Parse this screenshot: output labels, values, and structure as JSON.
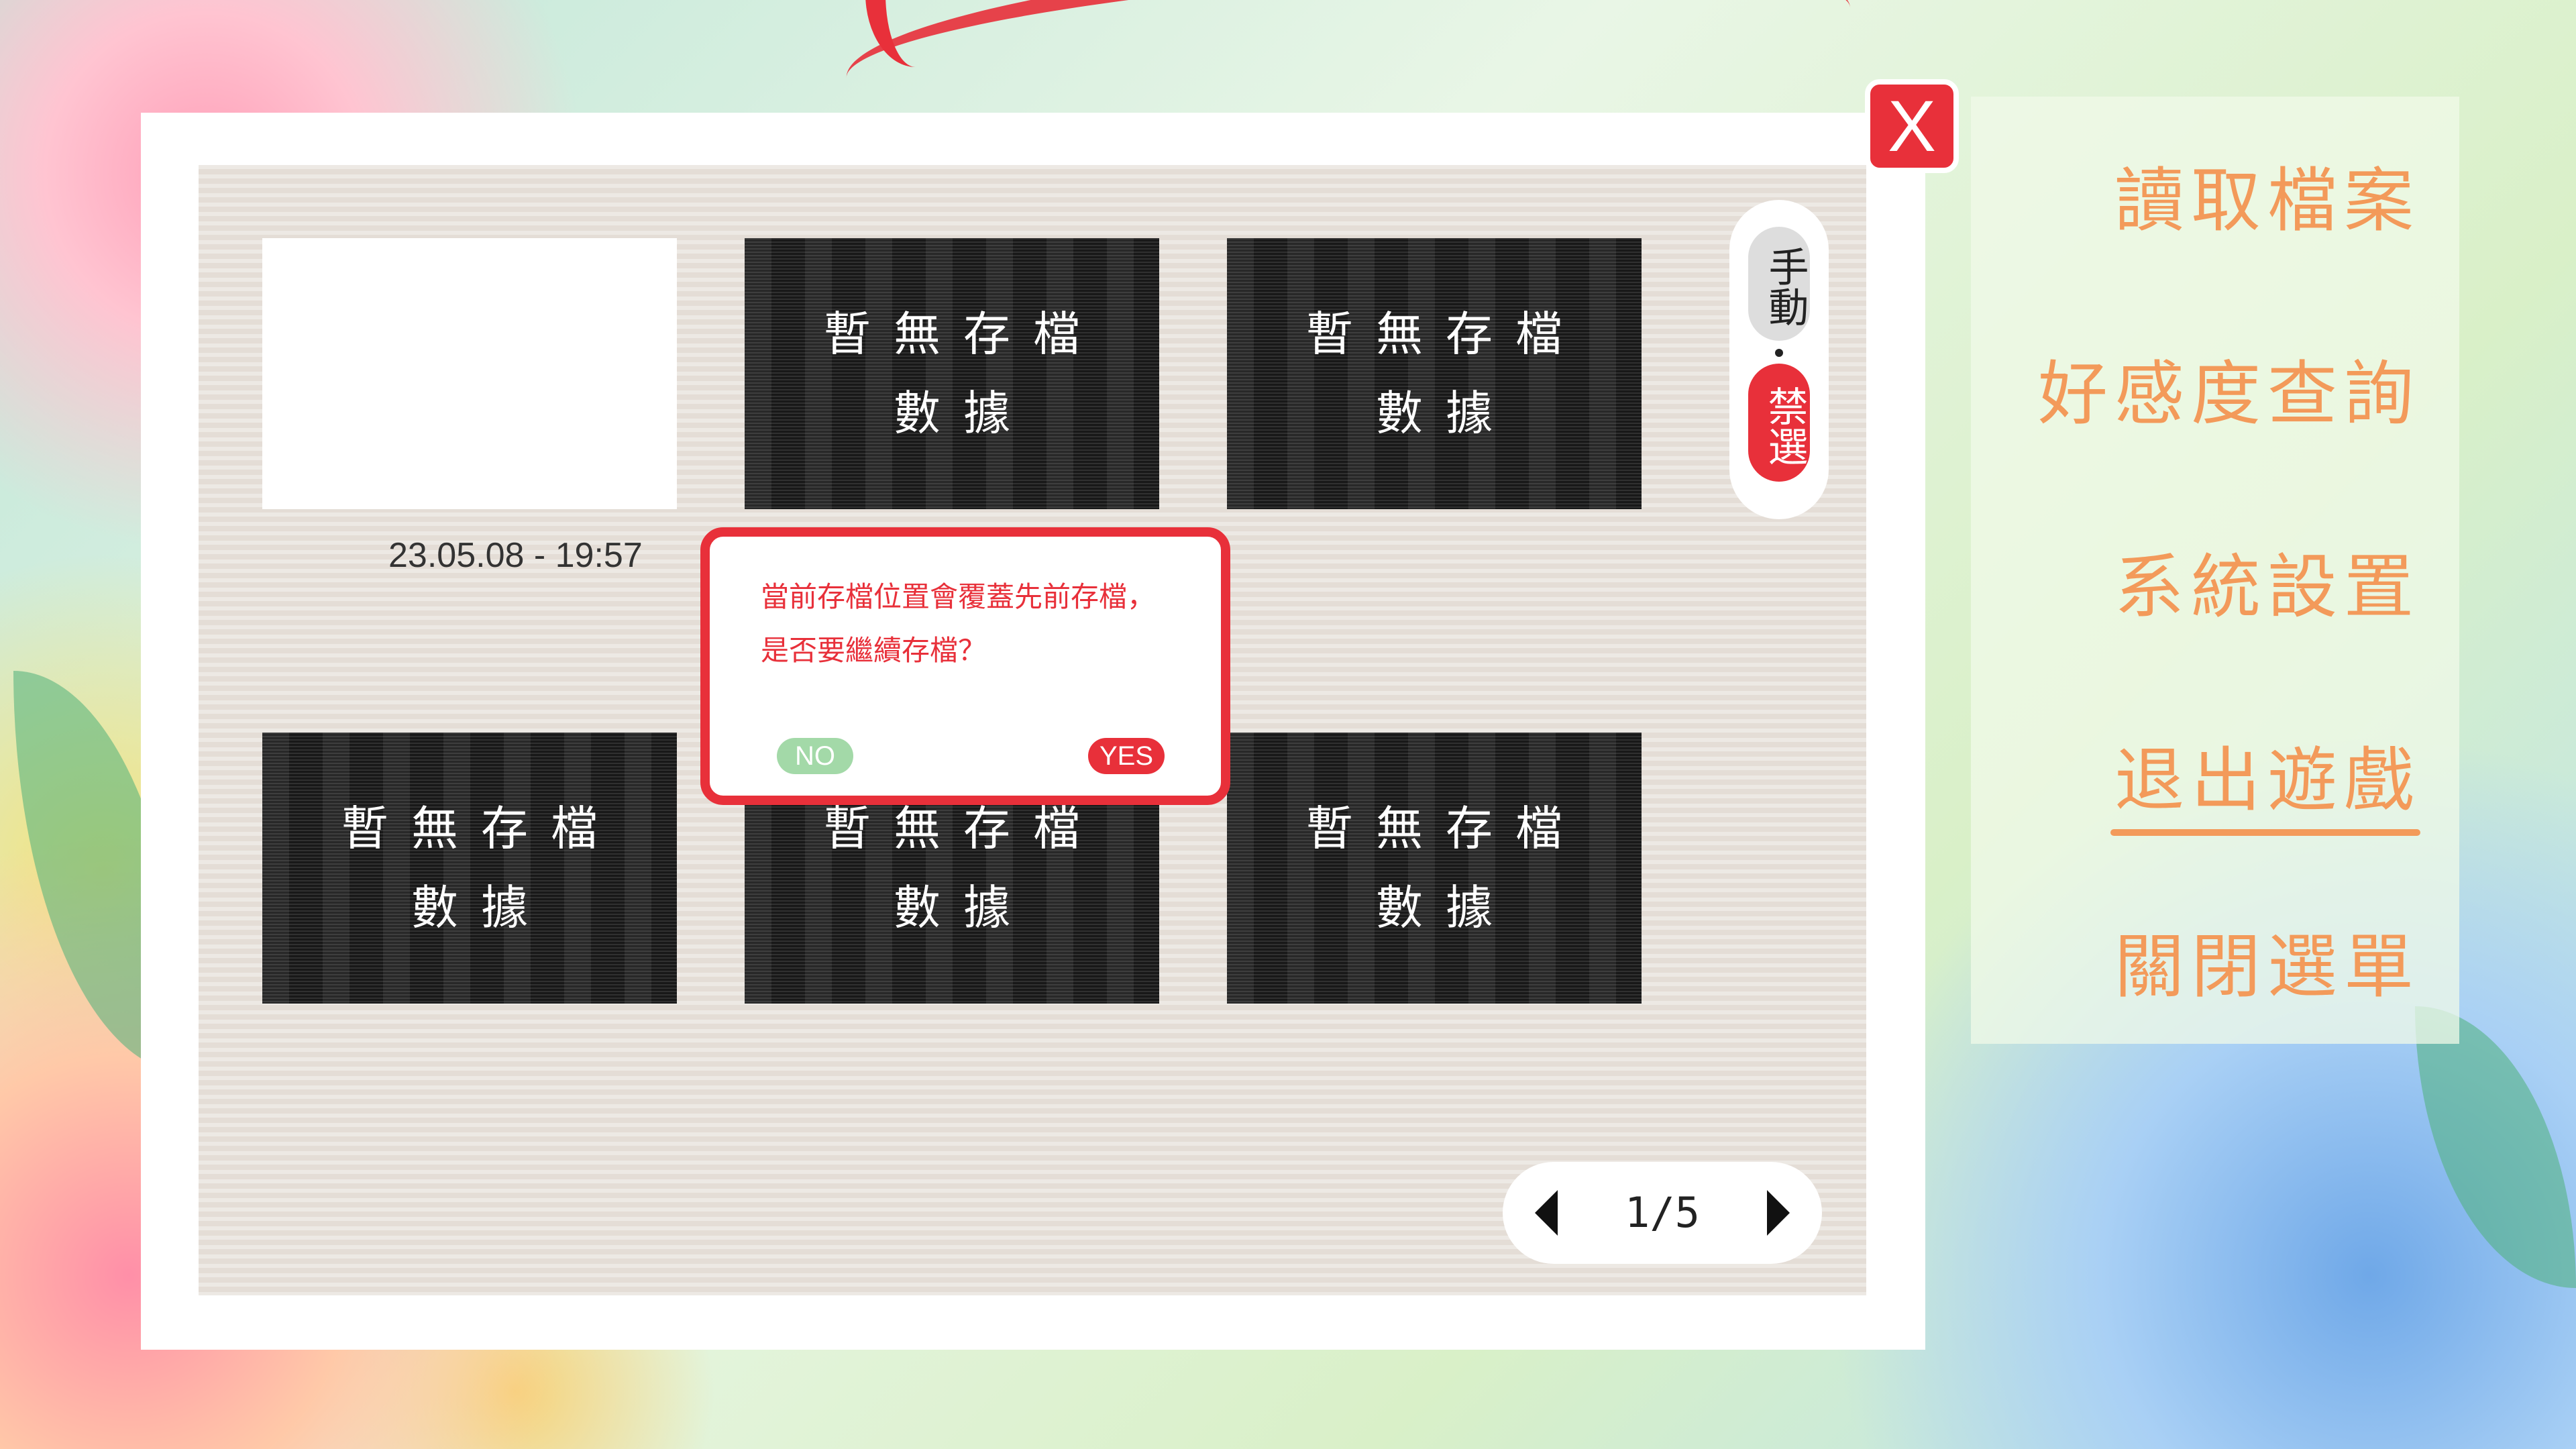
{
  "close_button": {
    "label": "X"
  },
  "mode": {
    "manual": "手動",
    "ban": "禁選"
  },
  "slots": [
    {
      "text1": "",
      "text2": "",
      "date": "23.05.08 - 19:57"
    },
    {
      "text1": "暫無存檔",
      "text2": "數據"
    },
    {
      "text1": "暫無存檔",
      "text2": "數據"
    },
    {
      "text1": "暫無存檔",
      "text2": "數據"
    },
    {
      "text1": "暫無存檔",
      "text2": "數據"
    },
    {
      "text1": "暫無存檔",
      "text2": "數據"
    }
  ],
  "confirm_dialog": {
    "line1": "當前存檔位置會覆蓋先前存檔，",
    "line2": "是否要繼續存檔？",
    "no_label": "NO",
    "yes_label": "YES"
  },
  "pager": {
    "label": "1/5"
  },
  "side_menu": {
    "items": [
      {
        "label": "讀取檔案"
      },
      {
        "label": "好感度查詢"
      },
      {
        "label": "系統設置"
      },
      {
        "label": "退出遊戲"
      },
      {
        "label": "關閉選單"
      }
    ],
    "selected_index": 3
  },
  "colors": {
    "accent_red": "#e8303a",
    "menu_orange": "#f39a5a",
    "no_green": "#a3d9a8"
  }
}
